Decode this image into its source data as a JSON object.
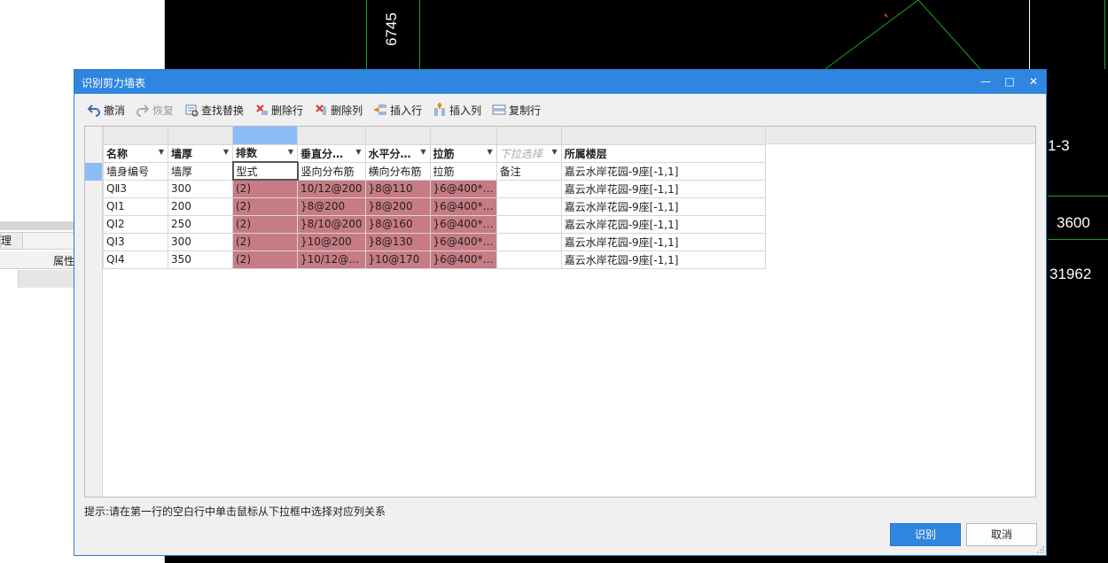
{
  "background": {
    "left_panel": {
      "tab_text": "管理",
      "header_text": "属性"
    },
    "cad_labels": [
      "6745",
      "1-3",
      "3600",
      "31962"
    ]
  },
  "dialog": {
    "title": "识别剪力墙表",
    "window_buttons": {
      "minimize": "—",
      "maximize": "□",
      "close": "✕"
    },
    "toolbar": [
      {
        "key": "undo",
        "label": "撤消",
        "icon": "undo-icon",
        "enabled": true
      },
      {
        "key": "redo",
        "label": "恢复",
        "icon": "redo-icon",
        "enabled": false
      },
      {
        "key": "find",
        "label": "查找替换",
        "icon": "find-replace-icon",
        "enabled": true
      },
      {
        "key": "delrow",
        "label": "删除行",
        "icon": "delete-row-icon",
        "enabled": true
      },
      {
        "key": "delcol",
        "label": "删除列",
        "icon": "delete-column-icon",
        "enabled": true
      },
      {
        "key": "insrow",
        "label": "插入行",
        "icon": "insert-row-icon",
        "enabled": true
      },
      {
        "key": "inscol",
        "label": "插入列",
        "icon": "insert-column-icon",
        "enabled": true
      },
      {
        "key": "copyrow",
        "label": "复制行",
        "icon": "copy-row-icon",
        "enabled": true
      }
    ],
    "table": {
      "headers": [
        "名称",
        "墙厚",
        "排数",
        "垂直分…",
        "水平分…",
        "拉筋",
        "下拉选择",
        "所属楼层"
      ],
      "rows": [
        [
          "墙身编号",
          "墙厚",
          "型式",
          "竖向分布筋",
          "横向分布筋",
          "拉筋",
          "备注",
          "嘉云水岸花园-9座[-1,1]"
        ],
        [
          "QⅡ3",
          "300",
          "(2)",
          "10/12@200",
          "}8@110",
          "}6@400*…",
          "",
          "嘉云水岸花园-9座[-1,1]"
        ],
        [
          "QⅠ1",
          "200",
          "(2)",
          "}8@200",
          "}8@200",
          "}6@400*…",
          "",
          "嘉云水岸花园-9座[-1,1]"
        ],
        [
          "QⅠ2",
          "250",
          "(2)",
          "}8/10@200",
          "}8@160",
          "}6@400*…",
          "",
          "嘉云水岸花园-9座[-1,1]"
        ],
        [
          "QⅠ3",
          "300",
          "(2)",
          "}10@200",
          "}8@130",
          "}6@400*…",
          "",
          "嘉云水岸花园-9座[-1,1]"
        ],
        [
          "QⅠ4",
          "350",
          "(2)",
          "}10/12@…",
          "}10@170",
          "}6@400*…",
          "",
          "嘉云水岸花园-9座[-1,1]"
        ]
      ]
    },
    "hint": "提示:请在第一行的空白行中单击鼠标从下拉框中选择对应列关系",
    "buttons": {
      "recognize": "识别",
      "cancel": "取消"
    },
    "colors": {
      "accent": "#2f86e0",
      "highlight": "#c77b84",
      "selected_col": "#8cbcf4"
    }
  }
}
